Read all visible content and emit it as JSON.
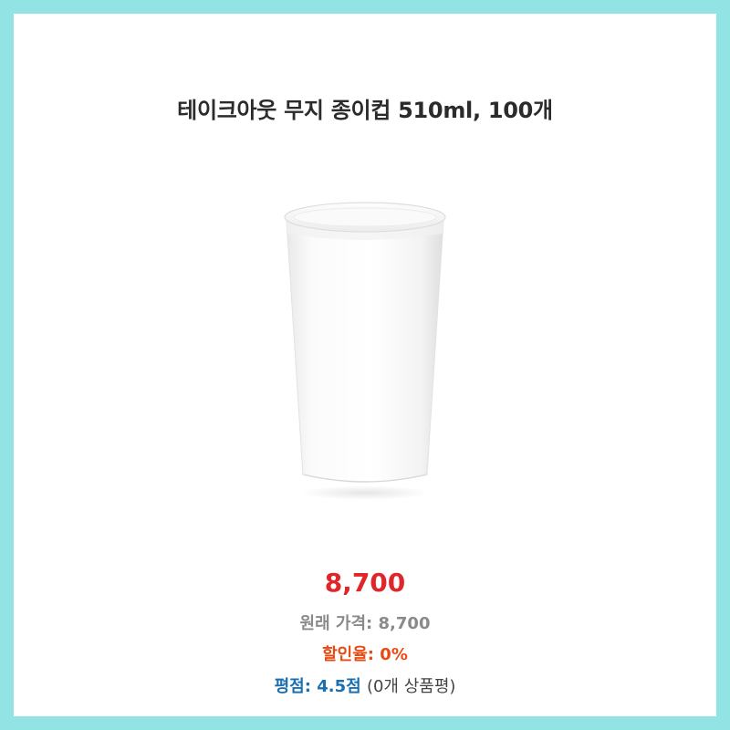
{
  "product": {
    "title": "테이크아웃 무지 종이컵 510ml, 100개",
    "price": "8,700",
    "original_price_label": "원래 가격:",
    "original_price": "8,700",
    "discount_label": "할인율:",
    "discount": "0%",
    "rating_label": "평점:",
    "rating": "4.5점",
    "review_count": "(0개 상품평)",
    "image_icon": "white-paper-cup"
  },
  "colors": {
    "border": "#91e4e3",
    "price": "#e0262b",
    "discount": "#ea4a12",
    "rating": "#1a6fb0",
    "muted": "#8a8a8a"
  }
}
